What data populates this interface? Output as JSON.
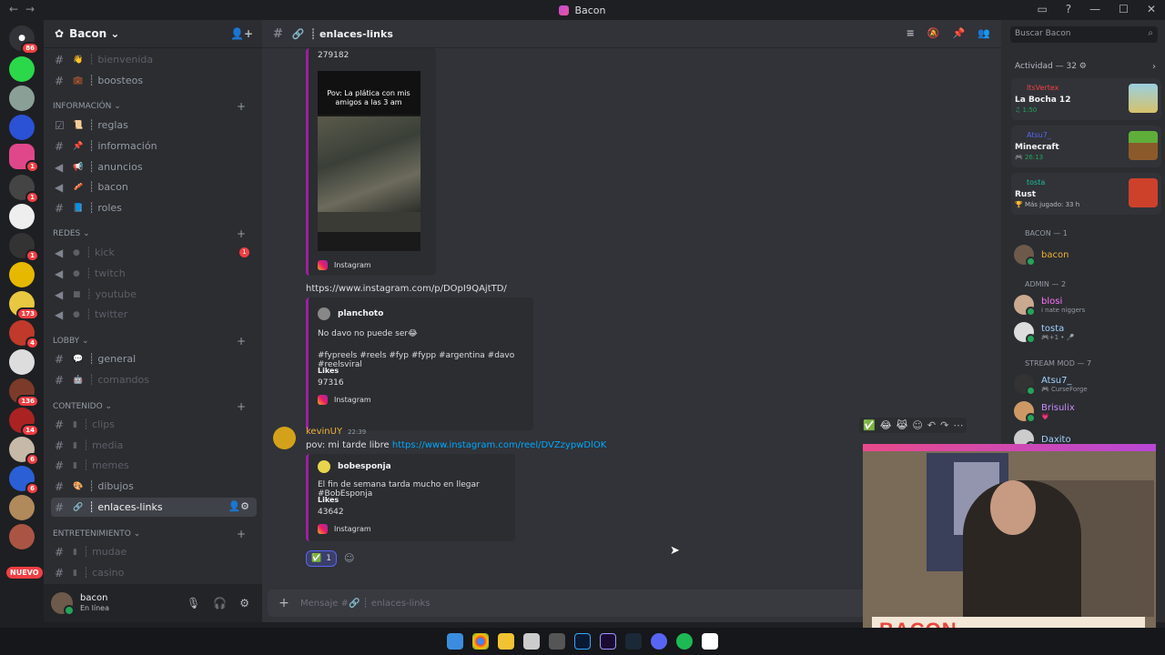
{
  "window": {
    "title": "Bacon",
    "controls": [
      "—",
      "☐",
      "✕"
    ]
  },
  "guild": {
    "name": "Bacon ⌄"
  },
  "servers": {
    "badges": [
      "86",
      "1",
      "1",
      "1",
      "173",
      "4",
      "136",
      "14",
      "6",
      "6"
    ],
    "new_label": "NUEVO"
  },
  "channels": {
    "top": [
      {
        "label": "┊ bienvenida",
        "emoji": "👋"
      },
      {
        "label": "┊ boosteos",
        "emoji": "💼"
      }
    ],
    "informacion": {
      "name": "INFORMACIÓN ⌄",
      "items": [
        {
          "label": "┊ reglas",
          "emoji": "📜"
        },
        {
          "label": "┊ información",
          "emoji": "📌"
        },
        {
          "label": "┊ anuncios",
          "emoji": "📢"
        },
        {
          "label": "┊ bacon",
          "emoji": "🥓"
        },
        {
          "label": "┊ roles",
          "emoji": "📘"
        }
      ]
    },
    "redes": {
      "name": "REDES ⌄",
      "items": [
        {
          "label": "┊ kick",
          "badge": "1"
        },
        {
          "label": "┊ twitch"
        },
        {
          "label": "┊ youtube"
        },
        {
          "label": "┊ twitter"
        }
      ]
    },
    "lobby": {
      "name": "LOBBY ⌄",
      "items": [
        {
          "label": "┊ general"
        },
        {
          "label": "┊ comandos"
        }
      ]
    },
    "contenido": {
      "name": "CONTENIDO ⌄",
      "items": [
        {
          "label": "┊ clips"
        },
        {
          "label": "┊ media"
        },
        {
          "label": "┊ memes"
        },
        {
          "label": "┊ dibujos"
        },
        {
          "label": "┊ enlaces-links"
        }
      ]
    },
    "entretenimiento": {
      "name": "ENTRETENIMIENTO ⌄",
      "items": [
        {
          "label": "┊ mudae"
        },
        {
          "label": "┊ casino"
        }
      ]
    }
  },
  "user_panel": {
    "name": "bacon",
    "status": "En línea"
  },
  "channel_header": {
    "name": "┊ enlaces-links"
  },
  "messages": {
    "embed1": {
      "likes_value": "279182",
      "video_caption": "Pov: La plática con mis amigos a las 3 am",
      "provider": "Instagram"
    },
    "link1": "https://www.instagram.com/p/DOpI9QAjtTD/",
    "embed2": {
      "author": "planchoto",
      "text": "No davo no puede ser😂",
      "tags": "#fypreels #reels #fyp #fypp #argentina #davo #reelsviral",
      "likes_label": "Likes",
      "likes_value": "97316",
      "provider": "Instagram"
    },
    "kevin": {
      "author": "kevinUY",
      "time": "22:39",
      "text_prefix": "pov: mi tarde libre ",
      "link": "https://www.instagram.com/reel/DVZzypwDlOK"
    },
    "embed3": {
      "author": "bobesponja",
      "text": "El fin de semana tarda mucho en llegar #BobEsponja",
      "likes_label": "Likes",
      "likes_value": "43642",
      "provider": "Instagram"
    },
    "reaction": {
      "emoji": "✅",
      "count": "1"
    }
  },
  "input": {
    "placeholder": "Mensaje #🔗 ┊ enlaces-links"
  },
  "members": {
    "search_placeholder": "Buscar Bacon",
    "activity_label": "Actividad — 32 ⚙",
    "activities": [
      {
        "user": "ItsVertex",
        "game": "La Bocha 12",
        "time": "♫ 1:50",
        "color": "#f23f43"
      },
      {
        "user": "Atsu7_",
        "game": "Minecraft",
        "time": "🎮 26:13",
        "color": "#5865f2"
      },
      {
        "user": "tosta",
        "game": "Rust",
        "time": "🏆 Más jugado: 33 h",
        "color": "#1abc9c"
      }
    ],
    "groups": [
      {
        "name": "BACON — 1",
        "members": [
          {
            "name": "bacon",
            "sub": "",
            "color": "#f0b232"
          }
        ]
      },
      {
        "name": "ADMIN — 2",
        "members": [
          {
            "name": "blosi",
            "sub": "i nate niggers",
            "color": "#ff73fa"
          },
          {
            "name": "tosta",
            "sub": "🎮+1 • 🎤",
            "color": "#a3d2ff"
          }
        ]
      },
      {
        "name": "Stream MOD — 7",
        "members": [
          {
            "name": "Atsu7_",
            "sub": "🎮 CurseForge",
            "color": "#a3d2ff"
          },
          {
            "name": "Brisulix",
            "sub": "💗",
            "color": "#c98bff"
          },
          {
            "name": "Daxito",
            "sub": "",
            "color": "#a3d2ff"
          }
        ]
      }
    ]
  },
  "webcam": {
    "overlay_text": "BACON"
  }
}
